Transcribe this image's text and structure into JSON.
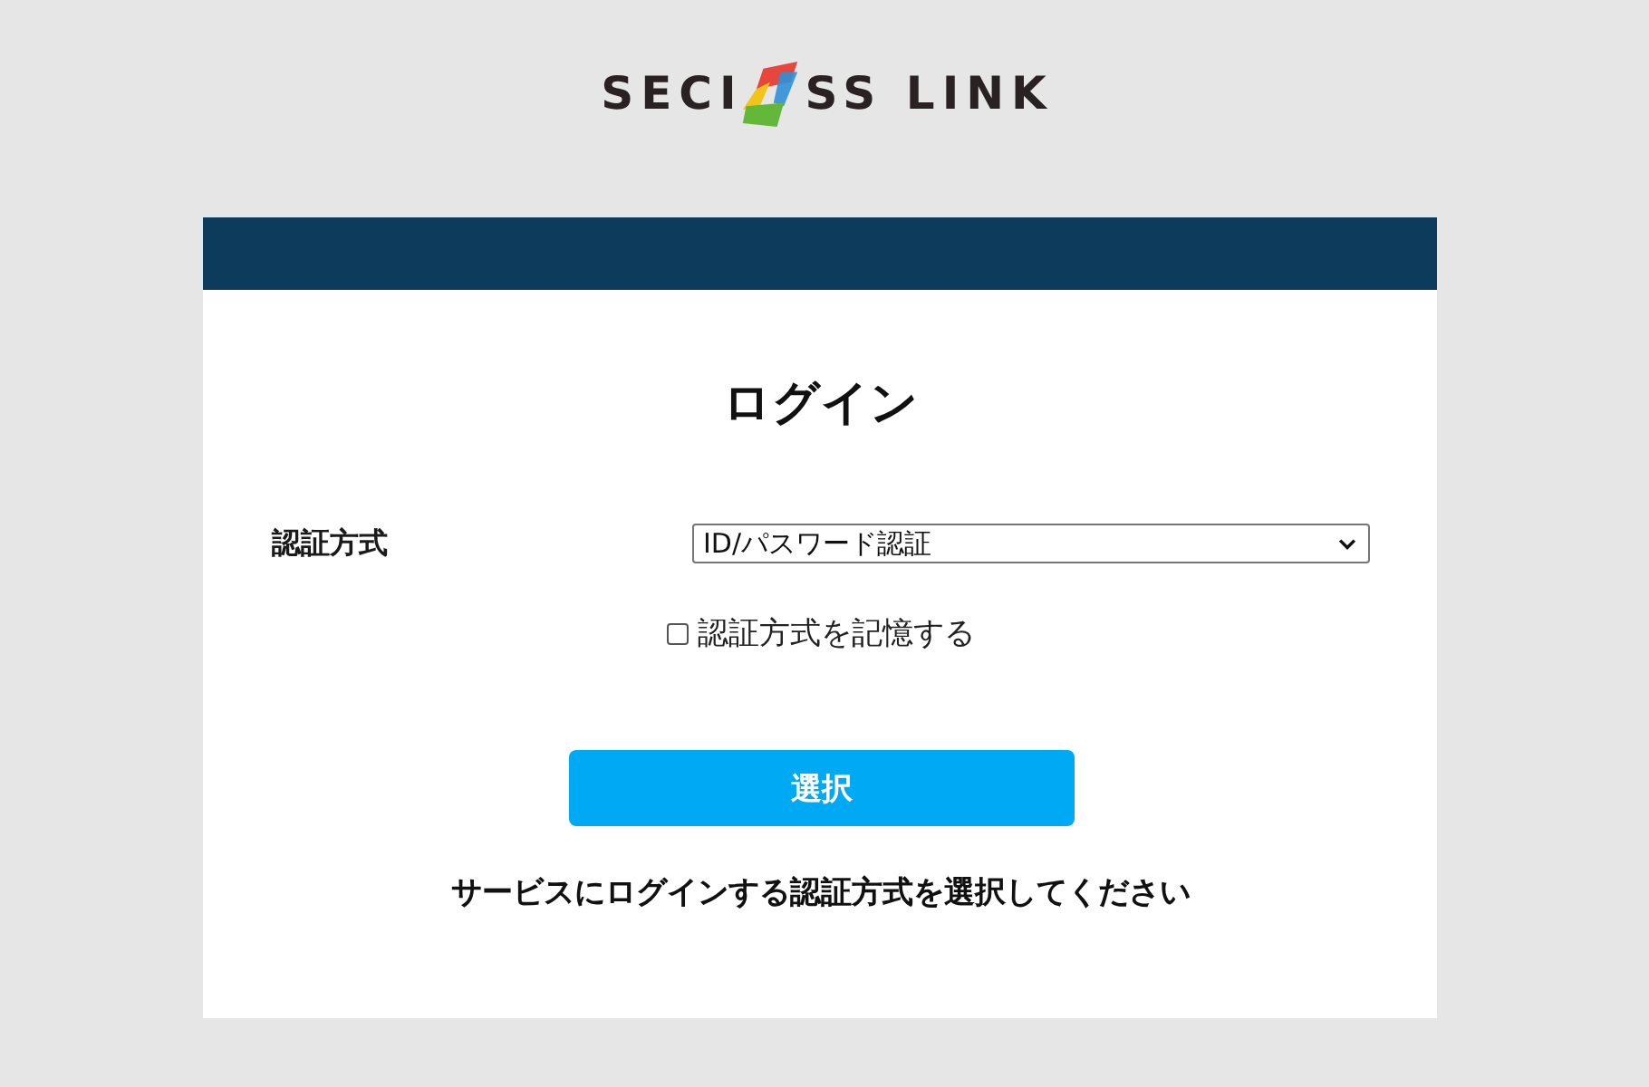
{
  "logo": {
    "text_before_mark": "SECI",
    "text_after_mark": "SS LINK"
  },
  "login": {
    "title": "ログイン",
    "method_label": "認証方式",
    "method_select": {
      "value": "ID/パスワード認証"
    },
    "remember": {
      "label": "認証方式を記憶する",
      "checked": false
    },
    "submit_button": "選択",
    "message": "サービスにログインする認証方式を選択してください"
  }
}
